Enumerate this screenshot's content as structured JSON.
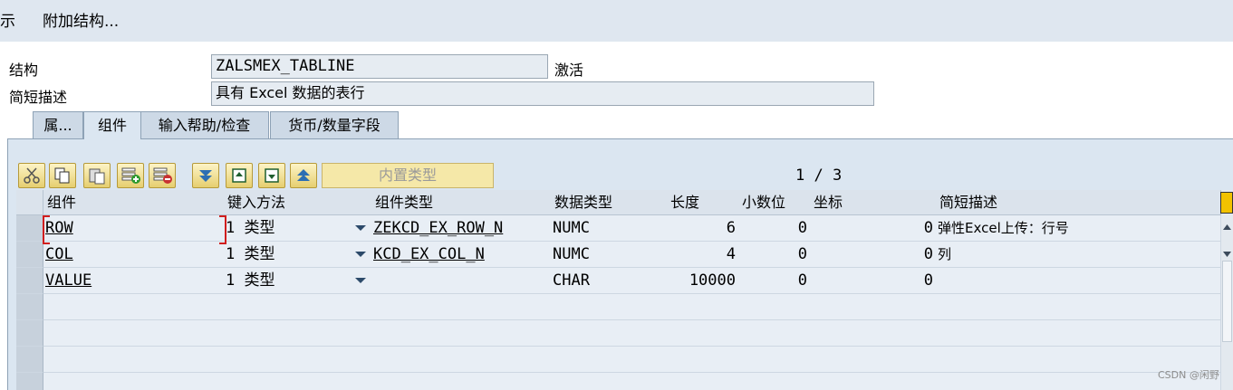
{
  "menubar": {
    "items": [
      "示",
      "附加结构..."
    ]
  },
  "header": {
    "structure_label": "结构",
    "structure_value": "ZALSMEX_TABLINE",
    "status": "激活",
    "desc_label": "简短描述",
    "desc_value": "具有 Excel 数据的表行"
  },
  "tabs": [
    {
      "label": "属..."
    },
    {
      "label": "组件"
    },
    {
      "label": "输入帮助/检查"
    },
    {
      "label": "货币/数量字段"
    }
  ],
  "toolbar": {
    "builtin_type_label": "内置类型",
    "page_counter": "1 / 3",
    "icons": [
      "cut-icon",
      "copy-icon",
      "paste-icon",
      "insert-row-icon",
      "delete-row-icon",
      "first-page-icon",
      "previous-page-icon",
      "next-page-icon",
      "last-page-icon"
    ]
  },
  "grid": {
    "columns": [
      "组件",
      "键入方法",
      "组件类型",
      "数据类型",
      "长度",
      "小数位",
      "坐标",
      "简短描述"
    ],
    "rows": [
      {
        "component": "ROW",
        "typing": "1 类型",
        "comp_type": "ZEKCD_EX_ROW_N",
        "data_type": "NUMC",
        "length": "6",
        "decimals": "0",
        "coord": "0",
        "desc": "弹性Excel上传：行号"
      },
      {
        "component": "COL",
        "typing": "1 类型",
        "comp_type": "KCD_EX_COL_N",
        "data_type": "NUMC",
        "length": "4",
        "decimals": "0",
        "coord": "0",
        "desc": "列"
      },
      {
        "component": "VALUE",
        "typing": "1 类型",
        "comp_type": "",
        "data_type": "CHAR",
        "length": "10000",
        "decimals": "0",
        "coord": "0",
        "desc": ""
      }
    ],
    "empty_rows": 4
  },
  "watermark": "CSDN @闲野",
  "colors": {
    "menubar_bg": "#dfe7f0",
    "panel_bg": "#dbe6f1",
    "grid_bg": "#e8eef5",
    "button_gold": "#e6cf70",
    "focus_red": "#d01e1e"
  }
}
